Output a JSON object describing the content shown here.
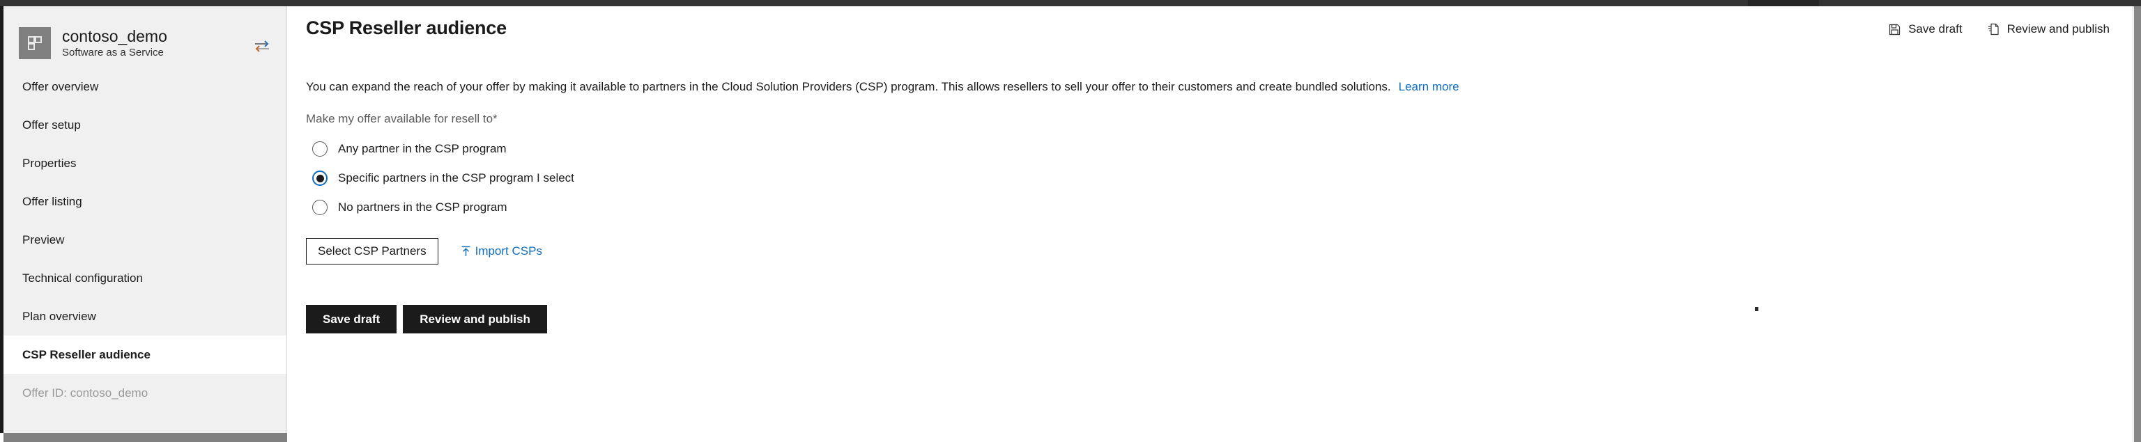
{
  "window": {
    "topbar_color": "#333333",
    "active_tab_color": "#262626"
  },
  "sidebar": {
    "offer": {
      "name": "contoso_demo",
      "type": "Software as a Service",
      "logo_icon": "tiles-grid-icon",
      "swap_icon": "swap-arrows-icon"
    },
    "items": [
      {
        "label": "Offer overview",
        "selected": false,
        "muted": false
      },
      {
        "label": "Offer setup",
        "selected": false,
        "muted": false
      },
      {
        "label": "Properties",
        "selected": false,
        "muted": false
      },
      {
        "label": "Offer listing",
        "selected": false,
        "muted": false
      },
      {
        "label": "Preview",
        "selected": false,
        "muted": false
      },
      {
        "label": "Technical configuration",
        "selected": false,
        "muted": false
      },
      {
        "label": "Plan overview",
        "selected": false,
        "muted": false
      },
      {
        "label": "CSP Reseller audience",
        "selected": true,
        "muted": false
      },
      {
        "label": "Offer ID: contoso_demo",
        "selected": false,
        "muted": true
      }
    ]
  },
  "header": {
    "title": "CSP Reseller audience",
    "actions": [
      {
        "label": "Save draft",
        "icon": "save-icon"
      },
      {
        "label": "Review and publish",
        "icon": "publish-document-icon"
      }
    ]
  },
  "main": {
    "intro_text": "You can expand the reach of your offer by making it available to partners in the Cloud Solution Providers (CSP) program. This allows resellers to sell your offer to their customers and create bundled solutions.",
    "learn_more_label": "Learn more",
    "field_label": "Make my offer available for resell to*",
    "radio_options": [
      {
        "label": "Any partner in the CSP program",
        "checked": false
      },
      {
        "label": "Specific partners in the CSP program I select",
        "checked": true
      },
      {
        "label": "No partners in the CSP program",
        "checked": false
      }
    ],
    "select_partners_label": "Select CSP Partners",
    "import_csps_label": "Import CSPs",
    "import_icon": "upload-icon",
    "footer_buttons": [
      {
        "label": "Save draft"
      },
      {
        "label": "Review and publish"
      }
    ]
  },
  "colors": {
    "accent_link": "#0f6cbd",
    "radio_selected_ring": "#0f6cbd",
    "primary_button_bg": "#1b1b1b",
    "sidebar_bg": "#f0f0f0"
  }
}
